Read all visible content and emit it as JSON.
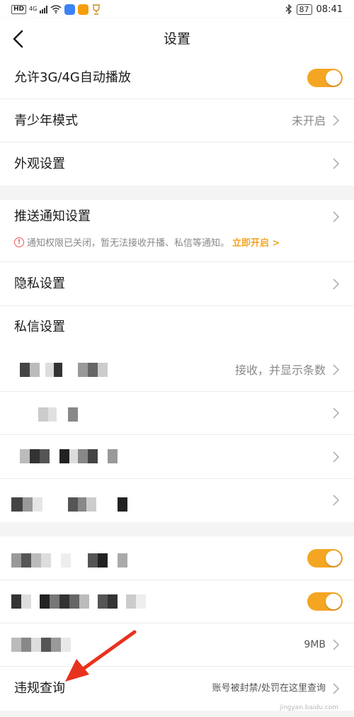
{
  "status_bar": {
    "hd": "HD",
    "network": "4G",
    "time": "08:41",
    "battery": "87",
    "colors": {
      "app1": "#3b82f6",
      "app2": "#f59e0b"
    }
  },
  "nav": {
    "title": "设置",
    "back_icon": "chevron-left-icon"
  },
  "settings": {
    "autoplay": {
      "label": "允许3G/4G自动播放",
      "on": true
    },
    "teen_mode": {
      "label": "青少年模式",
      "value": "未开启"
    },
    "appearance": {
      "label": "外观设置"
    },
    "push": {
      "label": "推送通知设置",
      "notice": "通知权限已关闭，暂无法接收开播、私信等通知。",
      "notice_link": "立即开启 >"
    },
    "privacy": {
      "label": "隐私设置"
    },
    "dm_section": {
      "label": "私信设置"
    },
    "dm_receive": {
      "value": "接收，并显示条数"
    },
    "cache": {
      "value": "9MB"
    },
    "violation": {
      "label": "违规查询",
      "value": "账号被封禁/处罚在这里查询"
    }
  },
  "accent_color": "#f4a623",
  "watermark": "jingyan.baidu.com"
}
